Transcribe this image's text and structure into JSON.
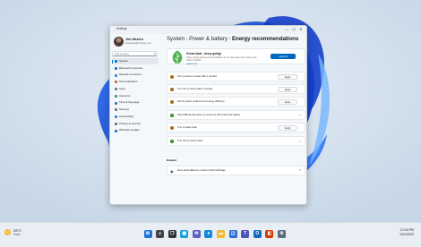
{
  "window": {
    "app_title": "Settings",
    "controls": [
      "—",
      "☐",
      "✕"
    ]
  },
  "user": {
    "name": "Jim Westen",
    "email": "jimwesten@contoso.com"
  },
  "search": {
    "placeholder": "Find a setting"
  },
  "sidebar": {
    "items": [
      {
        "label": "System",
        "color": "#0078d4",
        "active": true
      },
      {
        "label": "Bluetooth & devices",
        "color": "#1b6ec2"
      },
      {
        "label": "Network & internet",
        "color": "#2b88d8"
      },
      {
        "label": "Personalization",
        "color": "#c9603b"
      },
      {
        "label": "Apps",
        "color": "#6b7b8c"
      },
      {
        "label": "Accounts",
        "color": "#2e9e6b"
      },
      {
        "label": "Time & language",
        "color": "#1f7bc4"
      },
      {
        "label": "Gaming",
        "color": "#6c7a8a"
      },
      {
        "label": "Accessibility",
        "color": "#3a7bd5"
      },
      {
        "label": "Privacy & security",
        "color": "#5b6b7d"
      },
      {
        "label": "Windows Update",
        "color": "#1873c4"
      }
    ]
  },
  "breadcrumb": {
    "parts": [
      "System",
      "Power & battery"
    ],
    "separator": "›",
    "current": "Energy recommendations"
  },
  "hero": {
    "title": "Great start - keep going!",
    "description": "Apply energy-saving recommendations to use less power and reduce your carbon footprint.",
    "link": "Learn more",
    "apply_all_label": "Apply all",
    "leaf_color": "#4caf50"
  },
  "recommendations": [
    {
      "text": "Put my device to sleep after 3 minutes",
      "status": "warning",
      "action": "Apply"
    },
    {
      "text": "Turn off my screen after 3 minutes",
      "status": "warning",
      "action": "Apply"
    },
    {
      "text": "Set the power mode for best energy efficiency",
      "status": "warning",
      "action": "Apply"
    },
    {
      "text": "Stop USB devices when my screen is off to help save battery",
      "status": "done",
      "action": "chevron"
    },
    {
      "text": "Turn on dark mode",
      "status": "warning",
      "action": "Apply"
    },
    {
      "text": "Turn off my screen saver",
      "status": "done",
      "action": "chevron"
    }
  ],
  "status_colors": {
    "warning": "#a36a12",
    "done": "#1a8b1a"
  },
  "related": {
    "title": "Related",
    "item": "More about efficiency mode for Microsoft Edge"
  },
  "taskbar": {
    "weather": {
      "temp": "28°C",
      "condition": "Haze"
    },
    "apps": [
      {
        "name": "windows-start-icon",
        "color": "#1a73d9"
      },
      {
        "name": "search-icon",
        "color": "#444"
      },
      {
        "name": "task-view-icon",
        "color": "#333"
      },
      {
        "name": "widgets-icon",
        "color": "#1aa0d8"
      },
      {
        "name": "teams-chat-icon",
        "color": "#5a5fc4"
      },
      {
        "name": "edge-icon",
        "color": "#0f8bd6"
      },
      {
        "name": "file-explorer-icon",
        "color": "#f1b934"
      },
      {
        "name": "store-icon",
        "color": "#2f6fd1"
      },
      {
        "name": "teams-icon",
        "color": "#4b53bc"
      },
      {
        "name": "outlook-icon",
        "color": "#0f6cbd"
      },
      {
        "name": "office-icon",
        "color": "#d83b01"
      },
      {
        "name": "settings-icon",
        "color": "#5d6b7a"
      }
    ],
    "clock": {
      "time": "12:04 PM",
      "date": "10/1/2022"
    }
  }
}
